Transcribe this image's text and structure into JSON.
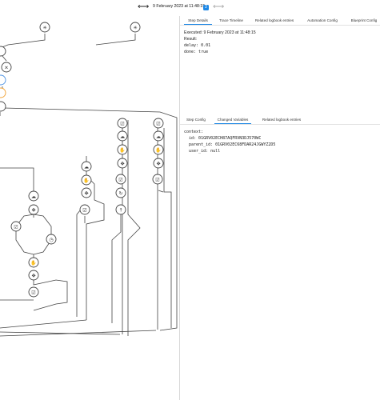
{
  "toolbar": {
    "nav_icon": "double-arrow",
    "date": "9 February 2023 at 11:48:15",
    "badge": "2",
    "next_icon": "arrow-left-right"
  },
  "trace_tabs": [
    "Step Details",
    "Trace Timeline",
    "Related logbook entries",
    "Automation Config",
    "Blueprint Config"
  ],
  "step_details": {
    "executed": "Executed: 9 February 2023 at 11:48:15",
    "result_label": "Result:",
    "lines": [
      "delay: 0.01",
      "done: true"
    ]
  },
  "step_tabs": [
    "Step Config",
    "Changed Variables",
    "Related logbook entries"
  ],
  "changed_variables": {
    "lines": [
      "context:",
      "  id: 01GRV02ECH87AQFRVN3DJ570WC",
      "  parent_id: 01GRV02EC68FDAR24JGWYZ2D5",
      "  user_id: null"
    ]
  },
  "colors": {
    "accent": "#1e88e5",
    "highlight_ring": "#4a90e2",
    "condition_ring": "#f0a030",
    "graph_line": "#444444"
  },
  "graph_icons": [
    "asterisk-icon",
    "asterisk-icon",
    "shuffle-icon",
    "close-icon",
    "play-icon",
    "bracket-icon",
    "shuffle-icon",
    "checkbox-icon",
    "checkbox-icon",
    "cloud-icon",
    "cloud-icon",
    "hand-icon",
    "hand-icon",
    "arrows-icon",
    "arrows-icon",
    "checkbox-icon",
    "checkbox-icon",
    "refresh-icon",
    "cloud-icon",
    "hand-icon",
    "arrows-icon",
    "checkbox-icon",
    "arrow-up-icon",
    "cloud-icon",
    "arrows-icon",
    "checkbox-icon",
    "timer-icon",
    "hand-icon",
    "arrows-icon",
    "checkbox-icon"
  ]
}
